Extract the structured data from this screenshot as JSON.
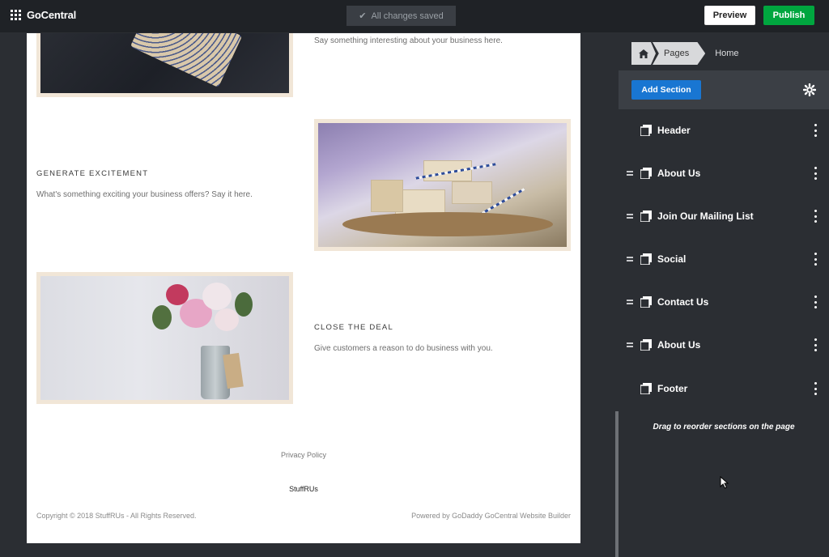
{
  "topbar": {
    "app_name": "GoCentral",
    "save_status": "All changes saved",
    "preview_label": "Preview",
    "publish_label": "Publish",
    "icons": {
      "menu": "apps-grid-icon",
      "saved": "check-icon"
    }
  },
  "site": {
    "row1_text": "Say something interesting about your business here.",
    "row2_heading": "GENERATE EXCITEMENT",
    "row2_text": "What's something exciting your business offers? Say it here.",
    "row3_heading": "CLOSE THE DEAL",
    "row3_text": "Give customers a reason to do business with you.",
    "privacy_link": "Privacy Policy",
    "site_name": "StuffRUs",
    "copyright": "Copyright © 2018 StuffRUs - All Rights Reserved.",
    "powered_by": "Powered by GoDaddy GoCentral Website Builder"
  },
  "sidebar": {
    "breadcrumb": {
      "pages": "Pages",
      "current": "Home"
    },
    "add_section_label": "Add Section",
    "sections": [
      {
        "label": "Header",
        "draggable": false
      },
      {
        "label": "About Us",
        "draggable": true
      },
      {
        "label": "Join Our Mailing List",
        "draggable": true
      },
      {
        "label": "Social",
        "draggable": true
      },
      {
        "label": "Contact Us",
        "draggable": true
      },
      {
        "label": "About Us",
        "draggable": true
      },
      {
        "label": "Footer",
        "draggable": false
      }
    ],
    "hint": "Drag to reorder sections on the page"
  },
  "colors": {
    "topbar_bg": "#1f2226",
    "sidebar_bg": "#2b2e33",
    "publish": "#00a63f",
    "add_section": "#1976d2"
  }
}
